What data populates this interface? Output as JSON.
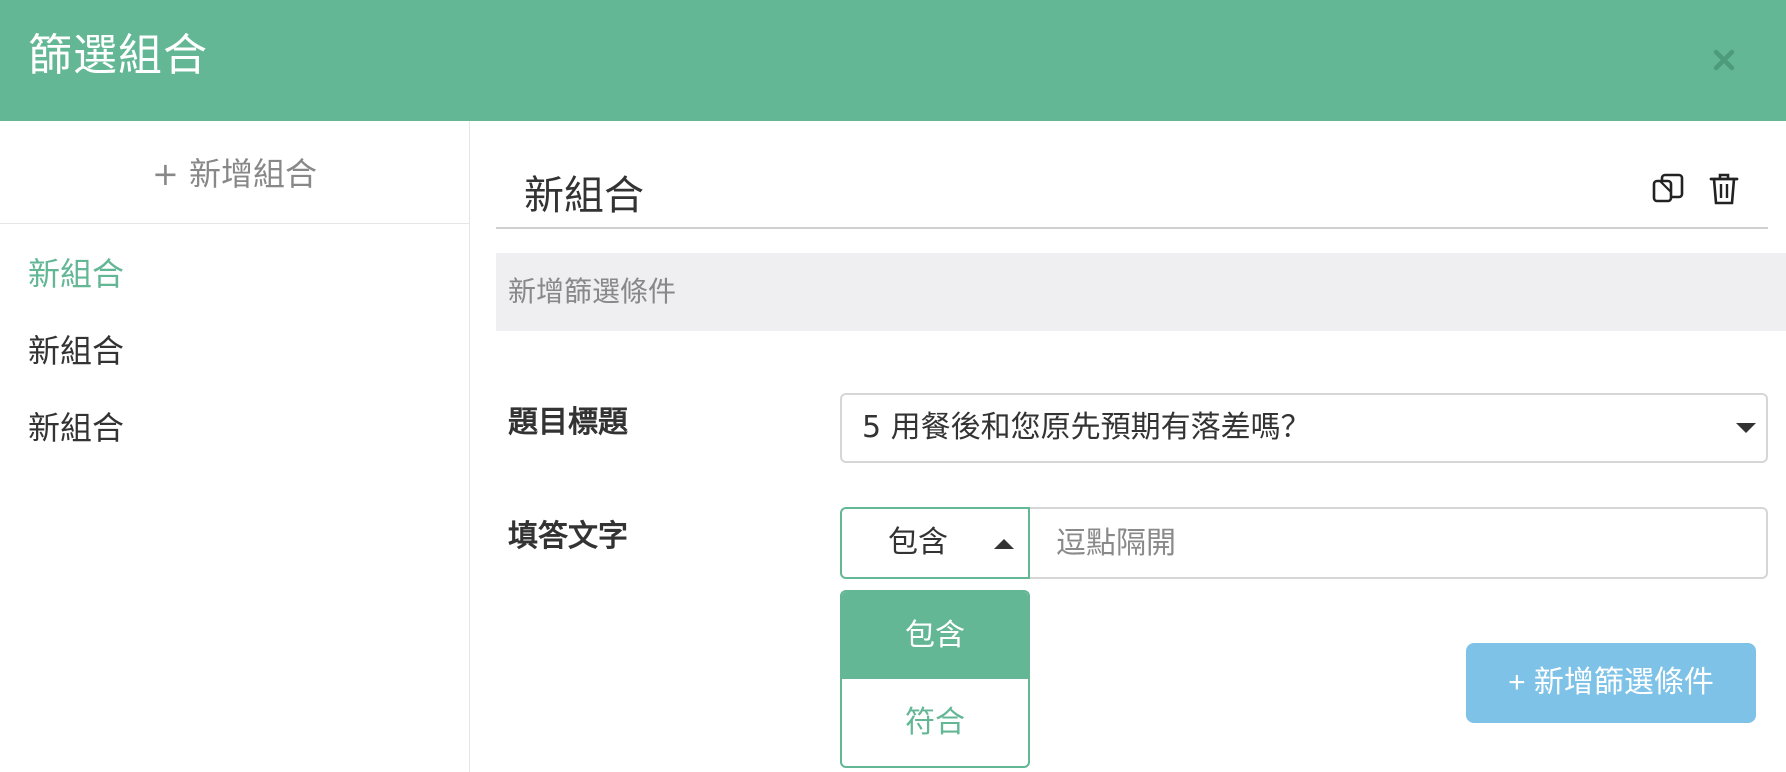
{
  "modal": {
    "title": "篩選組合",
    "close_icon": "close-icon"
  },
  "colors": {
    "accent": "#63b795",
    "button_blue": "#7ec2e8",
    "section_bg": "#efeef0"
  },
  "sidebar": {
    "add_group_label": "+ 新增組合",
    "groups": [
      {
        "label": "新組合",
        "active": true
      },
      {
        "label": "新組合",
        "active": false
      },
      {
        "label": "新組合",
        "active": false
      }
    ]
  },
  "main": {
    "group_name": "新組合",
    "copy_icon": "copy-icon",
    "trash_icon": "trash-icon",
    "section_title": "新增篩選條件",
    "question_label": "題目標題",
    "question_value": "5 用餐後和您原先預期有落差嗎？",
    "answer_label": "填答文字",
    "operator_value": "包含",
    "answer_placeholder": "逗點隔開",
    "operator_options": [
      {
        "label": "包含",
        "selected": true
      },
      {
        "label": "符合",
        "selected": false
      }
    ],
    "add_condition_label": "+ 新增篩選條件"
  }
}
